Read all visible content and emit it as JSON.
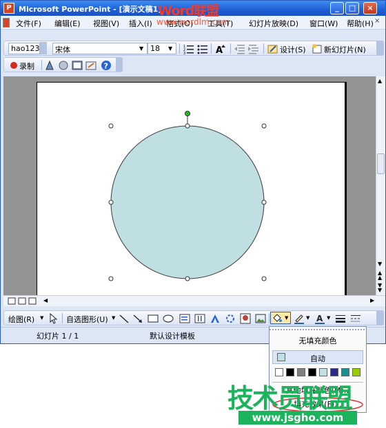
{
  "window": {
    "title": "Microsoft PowerPoint - [演示文稿1]",
    "min_label": "_",
    "max_label": "□",
    "close_label": "×"
  },
  "watermark": {
    "top_word": "Word联盟",
    "top_url": "www.wordlm.com",
    "bottom_big": "技术员联盟",
    "bottom_url": "www.jsgho.com"
  },
  "menu": [
    "文件(F)",
    "编辑(E)",
    "视图(V)",
    "插入(I)",
    "格式(O)",
    "工具(T)",
    "幻灯片放映(D)",
    "窗口(W)",
    "帮助(H)"
  ],
  "formatting": {
    "style_field": "hao123",
    "font_field": "宋体",
    "size_field": "18",
    "design_label": "设计(S)",
    "new_slide_label": "新幻灯片(N)"
  },
  "macro_toolbar": {
    "record_label": "录制"
  },
  "drawing_toolbar": {
    "draw_label": "绘图(R)",
    "autoshapes_label": "自选图形(U)"
  },
  "status_bar": {
    "slide_info": "幻灯片 1 / 1",
    "template_name": "默认设计模板"
  },
  "fill_popup": {
    "no_fill": "无填充颜色",
    "auto": "自动",
    "colors": [
      "#ffffff",
      "#000000",
      "#808080",
      "#000000",
      "#c0e0e4",
      "#2a2a8a",
      "#1a9090",
      "#99cc00"
    ],
    "more_colors": "其他填充颜色(M)...",
    "fill_effects": "填充效果(F)..."
  },
  "shape": {
    "type": "circle",
    "fill": "#c0dfe3",
    "stroke": "#3a3a3a",
    "rotate_handle_color": "#22bb22"
  }
}
